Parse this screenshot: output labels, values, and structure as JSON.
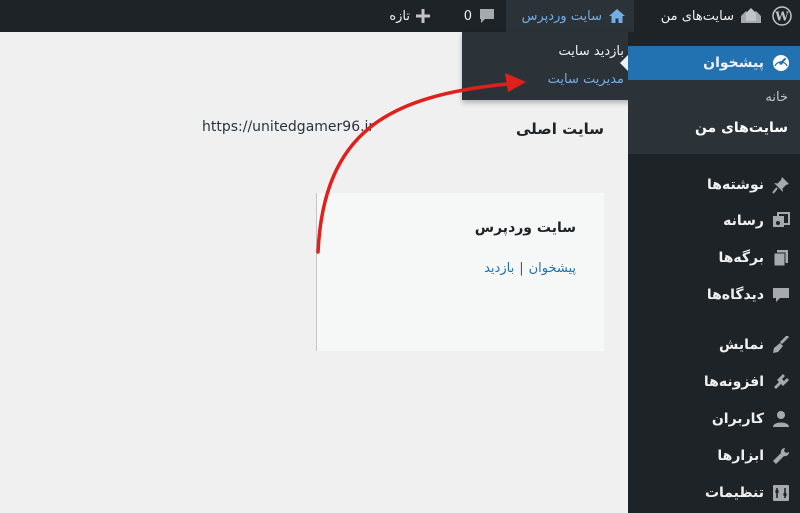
{
  "admin_bar": {
    "my_sites": "سایت‌های من",
    "site_name": "سایت وردپرس",
    "comments_count": "0",
    "new_label": "تازه"
  },
  "site_menu": {
    "visit_site": "بازدید سایت",
    "manage_site": "مدیریت سایت"
  },
  "sidebar": {
    "dashboard": "پیشخوان",
    "sub_items": [
      "خانه",
      "سایت‌های من"
    ],
    "items": [
      {
        "label": "نوشته‌ها",
        "icon": "pin-icon"
      },
      {
        "label": "رسانه",
        "icon": "media-icon"
      },
      {
        "label": "برگه‌ها",
        "icon": "pages-icon"
      },
      {
        "label": "دیدگاه‌ها",
        "icon": "comments-icon"
      },
      {
        "label": "نمایش",
        "icon": "appearance-icon"
      },
      {
        "label": "افزونه‌ها",
        "icon": "plugins-icon"
      },
      {
        "label": "کاربران",
        "icon": "users-icon"
      },
      {
        "label": "ابزارها",
        "icon": "tools-icon"
      },
      {
        "label": "تنظیمات",
        "icon": "settings-icon"
      }
    ]
  },
  "main": {
    "primary_site_label": "سایت اصلی",
    "primary_site_url": "https://unitedgamer96.ir",
    "site_card": {
      "title": "سایت وردپرس",
      "visit_link": "بازدید",
      "separator": "|",
      "dashboard_link": "پیشخوان"
    }
  },
  "annotation_color": "#e0201b",
  "theme": {
    "bar": "#1d2327",
    "submenu": "#2c3338",
    "accent": "#2271b1",
    "link": "#72aee6"
  }
}
